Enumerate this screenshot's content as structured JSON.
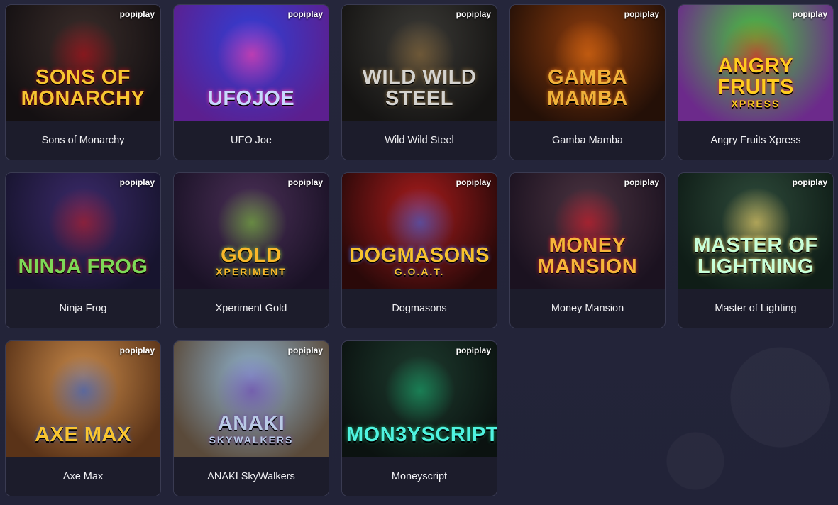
{
  "provider_label": "popiplay",
  "games": [
    {
      "title": "Sons of Monarchy",
      "logo": "SONS OF MONARCHY",
      "logo_sub": "",
      "theme": "gorilla-king-art",
      "colors": {
        "bg1": "#3a2d2a",
        "bg2": "#141012",
        "logo": "#f7c531",
        "glow": "#b0101a"
      }
    },
    {
      "title": "UFO Joe",
      "logo": "UFOJOE",
      "logo_sub": "",
      "theme": "ufo-art",
      "colors": {
        "bg1": "#2f3fd6",
        "bg2": "#5c1f8f",
        "logo": "#c9d7ff",
        "glow": "#ff3fa6"
      }
    },
    {
      "title": "Wild Wild Steel",
      "logo": "WILD WILD STEEL",
      "logo_sub": "",
      "theme": "cowboy-skull-art",
      "colors": {
        "bg1": "#3b3a36",
        "bg2": "#151413",
        "logo": "#d5d3cf",
        "glow": "#8a6a3b"
      }
    },
    {
      "title": "Gamba Mamba",
      "logo": "GAMBA MAMBA",
      "logo_sub": "",
      "theme": "tribal-mask-art",
      "colors": {
        "bg1": "#8a3b0d",
        "bg2": "#241007",
        "logo": "#f1b23b",
        "glow": "#e26d12"
      }
    },
    {
      "title": "Angry Fruits Xpress",
      "logo": "ANGRY FRUITS",
      "logo_sub": "XPRESS",
      "theme": "angry-fruit-art",
      "colors": {
        "bg1": "#46c83a",
        "bg2": "#6c2a8b",
        "logo": "#ffcc1f",
        "glow": "#e3212b"
      }
    },
    {
      "title": "Ninja Frog",
      "logo": "NINJA FROG",
      "logo_sub": "",
      "theme": "ninja-frog-art",
      "colors": {
        "bg1": "#3b2a6a",
        "bg2": "#17142e",
        "logo": "#7ed957",
        "glow": "#b21e2a"
      }
    },
    {
      "title": "Xperiment Gold",
      "logo": "GOLD",
      "logo_sub": "XPERIMENT",
      "theme": "wizard-art",
      "colors": {
        "bg1": "#4a2f56",
        "bg2": "#1a1226",
        "logo": "#f9b82a",
        "glow": "#7ab93d"
      }
    },
    {
      "title": "Dogmasons",
      "logo": "DOGMASONS",
      "logo_sub": "G.O.A.T.",
      "theme": "dog-throne-art",
      "colors": {
        "bg1": "#a91c1c",
        "bg2": "#2a0909",
        "logo": "#f7c22e",
        "glow": "#3f63d6"
      }
    },
    {
      "title": "Money Mansion",
      "logo": "MONEY MANSION",
      "logo_sub": "",
      "theme": "clown-art",
      "colors": {
        "bg1": "#4b3340",
        "bg2": "#1b1220",
        "logo": "#f7b53a",
        "glow": "#d21d2b"
      }
    },
    {
      "title": "Master of Lighting",
      "logo": "MASTER OF LIGHTNING",
      "logo_sub": "",
      "theme": "lightning-orb-art",
      "colors": {
        "bg1": "#2e4a3a",
        "bg2": "#0f1d17",
        "logo": "#c8ffd8",
        "glow": "#f2d46b"
      }
    },
    {
      "title": "Axe Max",
      "logo": "AXE MAX",
      "logo_sub": "",
      "theme": "warrior-art",
      "colors": {
        "bg1": "#c98a4a",
        "bg2": "#5a3318",
        "logo": "#f9c531",
        "glow": "#2e5ec8"
      }
    },
    {
      "title": "ANAKI SkyWalkers",
      "logo": "ANAKI",
      "logo_sub": "SKYWALKERS",
      "theme": "eagle-pharaoh-art",
      "colors": {
        "bg1": "#8fb3cf",
        "bg2": "#5a4a3a",
        "logo": "#b9c9e6",
        "glow": "#6a3fa8"
      }
    },
    {
      "title": "Moneyscript",
      "logo": "MON3YSCRIPT",
      "logo_sub": "",
      "theme": "hooded-hacker-art",
      "colors": {
        "bg1": "#1d3b2e",
        "bg2": "#0b1210",
        "logo": "#4ff3e0",
        "glow": "#1aa36a"
      }
    }
  ]
}
